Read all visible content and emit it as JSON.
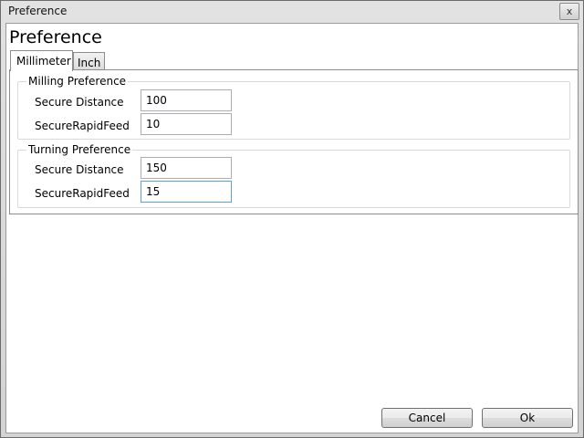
{
  "window": {
    "title": "Preference",
    "close_glyph": "x"
  },
  "heading": "Preference",
  "tabs": [
    {
      "label": "Millimeter",
      "active": true
    },
    {
      "label": "Inch",
      "active": false
    }
  ],
  "groups": [
    {
      "title": "Milling Preference",
      "fields": [
        {
          "label": "Secure Distance",
          "value": "100"
        },
        {
          "label": "SecureRapidFeed",
          "value": "10"
        }
      ]
    },
    {
      "title": "Turning Preference",
      "fields": [
        {
          "label": "Secure Distance",
          "value": "150"
        },
        {
          "label": "SecureRapidFeed",
          "value": "15"
        }
      ]
    }
  ],
  "buttons": {
    "cancel": "Cancel",
    "ok": "Ok"
  }
}
